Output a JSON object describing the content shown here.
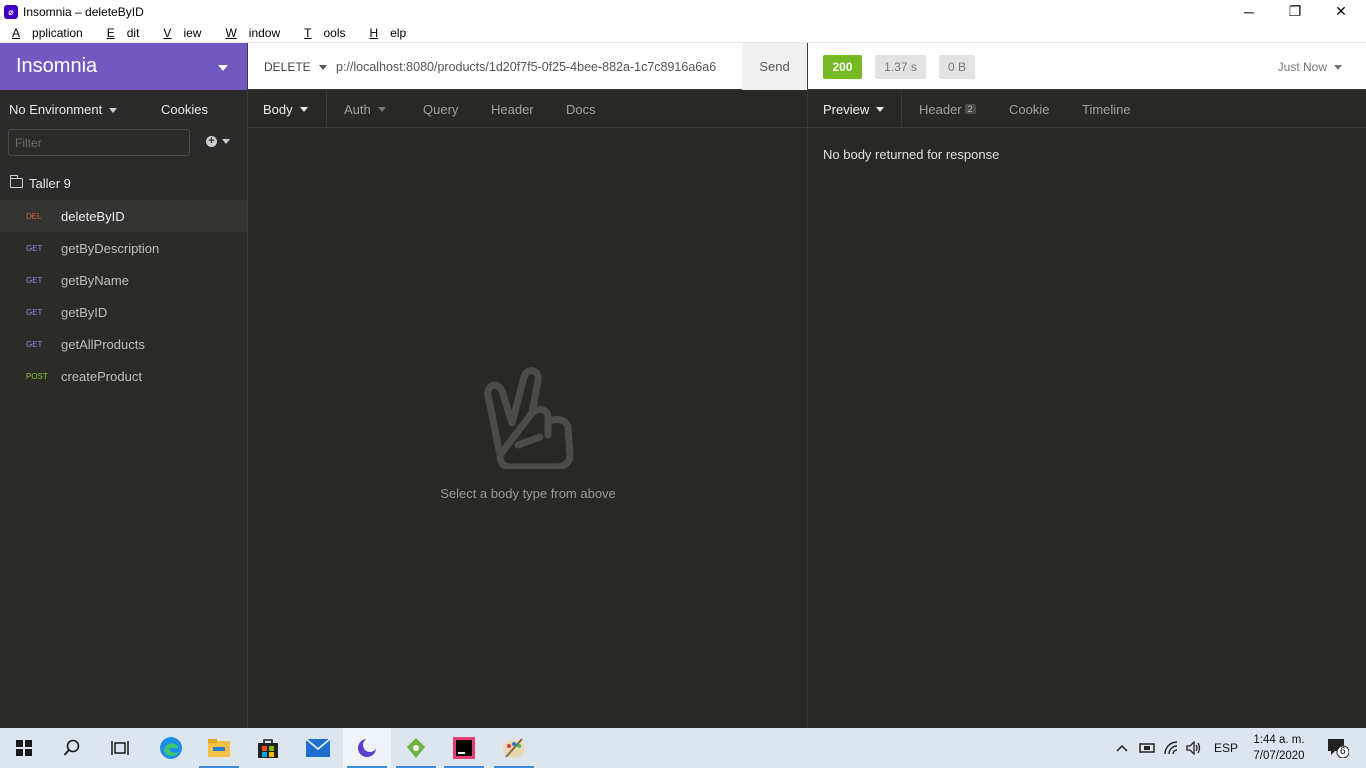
{
  "window": {
    "app_icon": "insomnia-app-icon",
    "title": "Insomnia – deleteByID",
    "minimize": "─",
    "restore": "❐",
    "close": "✕"
  },
  "menu": {
    "items": [
      {
        "mnemonic": "A",
        "rest": "pplication"
      },
      {
        "mnemonic": "E",
        "rest": "dit"
      },
      {
        "mnemonic": "V",
        "rest": "iew"
      },
      {
        "mnemonic": "W",
        "rest": "indow"
      },
      {
        "mnemonic": "T",
        "rest": "ools"
      },
      {
        "mnemonic": "H",
        "rest": "elp"
      }
    ]
  },
  "sidebar": {
    "workspace_name": "Insomnia",
    "environment": "No Environment",
    "cookies": "Cookies",
    "filter_placeholder": "Filter",
    "folder": "Taller 9",
    "requests": [
      {
        "method": "DEL",
        "name": "deleteByID",
        "active": true
      },
      {
        "method": "GET",
        "name": "getByDescription",
        "active": false
      },
      {
        "method": "GET",
        "name": "getByName",
        "active": false
      },
      {
        "method": "GET",
        "name": "getByID",
        "active": false
      },
      {
        "method": "GET",
        "name": "getAllProducts",
        "active": false
      },
      {
        "method": "POST",
        "name": "createProduct",
        "active": false
      }
    ]
  },
  "request": {
    "method": "DELETE",
    "url": "p://localhost:8080/products/1d20f7f5-0f25-4bee-882a-1c7c8916a6a6",
    "send": "Send",
    "tabs": {
      "body": "Body",
      "auth": "Auth",
      "query": "Query",
      "header": "Header",
      "docs": "Docs"
    },
    "empty_message": "Select a body type from above"
  },
  "response": {
    "status": "200",
    "time": "1.37 s",
    "size": "0 B",
    "when": "Just Now",
    "tabs": {
      "preview": "Preview",
      "header": "Header",
      "header_count": "2",
      "cookie": "Cookie",
      "timeline": "Timeline"
    },
    "message": "No body returned for response"
  },
  "taskbar": {
    "language": "ESP",
    "time": "1:44 a. m.",
    "date": "7/07/2020",
    "notifications": "6"
  },
  "colors": {
    "accent": "#7159c1",
    "status_ok": "#75ba24",
    "method_delete": "#e0533e",
    "method_get": "#8d8fe6",
    "method_post": "#7ec620"
  }
}
